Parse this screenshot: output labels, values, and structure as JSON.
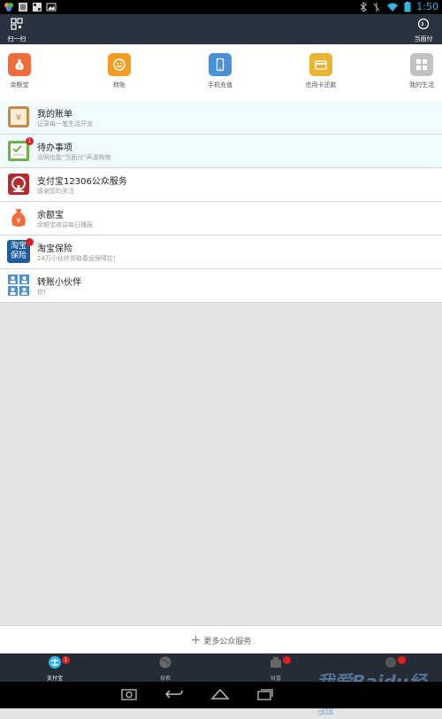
{
  "status": {
    "time": "1:50"
  },
  "topbar": {
    "scan_label": "扫一扫",
    "pay_label": "当面付"
  },
  "quick_actions": [
    {
      "label": "余额宝",
      "color": "#f26b3a"
    },
    {
      "label": "转账",
      "color": "#f39c22"
    },
    {
      "label": "手机充值",
      "color": "#4a90d9"
    },
    {
      "label": "信用卡还款",
      "color": "#eab331"
    },
    {
      "label": "我的生活",
      "color": "#c2c2c2"
    }
  ],
  "list": [
    {
      "title": "我的账单",
      "sub": "记录每一笔生活开支",
      "icon": "bill-icon"
    },
    {
      "title": "待办事项",
      "sub": "没网也能\"当面付\"声波购物",
      "icon": "todo-icon",
      "badge": "1"
    },
    {
      "title": "支付宝12306公众服务",
      "sub": "感谢您的关注",
      "icon": "railway-icon"
    },
    {
      "title": "余额宝",
      "sub": "余额宝收益每日播报",
      "icon": "money-bag-icon"
    },
    {
      "title": "淘宝保险",
      "sub": "24万小伙伴领取春运保障拉！",
      "icon": "taobao-insurance-icon",
      "badge": ""
    },
    {
      "title": "转账小伙伴",
      "sub": "你!",
      "icon": "contacts-icon"
    }
  ],
  "more": {
    "label": "更多公众服务"
  },
  "tabs": [
    {
      "label": "支付宝",
      "badge": "1"
    },
    {
      "label": "探索"
    },
    {
      "label": "财富"
    },
    {
      "label": ""
    }
  ],
  "watermark": {
    "text1": "我爱Baidu经验",
    "text2": "jingyan.baidu.com"
  },
  "colors": {
    "header": "#2b3240",
    "tabbar": "#262c35",
    "accent": "#31b6e7"
  }
}
